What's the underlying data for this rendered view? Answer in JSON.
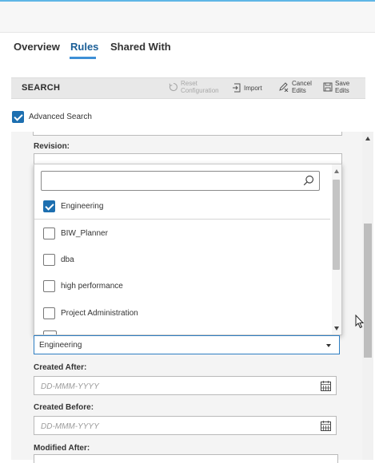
{
  "tabs": [
    {
      "label": "Overview",
      "active": false
    },
    {
      "label": "Rules",
      "active": true
    },
    {
      "label": "Shared With",
      "active": false
    }
  ],
  "toolbar": {
    "title": "SEARCH",
    "reset_line1": "Reset",
    "reset_line2": "Configuration",
    "import_label": "Import",
    "cancel_line1": "Cancel",
    "cancel_line2": "Edits",
    "save_line1": "Save",
    "save_line2": "Edits"
  },
  "advanced_search": {
    "label": "Advanced Search",
    "checked": true
  },
  "form": {
    "revision_label": "Revision:",
    "group_select_value": "Engineering",
    "created_after_label": "Created After:",
    "created_after_placeholder": "DD-MMM-YYYY",
    "created_before_label": "Created Before:",
    "created_before_placeholder": "DD-MMM-YYYY",
    "modified_after_label": "Modified After:"
  },
  "dropdown": {
    "search_value": "",
    "options": [
      {
        "label": "Engineering",
        "checked": true
      },
      {
        "label": "BIW_Planner",
        "checked": false
      },
      {
        "label": "dba",
        "checked": false
      },
      {
        "label": "high performance",
        "checked": false
      },
      {
        "label": "Project Administration",
        "checked": false
      }
    ]
  },
  "colors": {
    "accent": "#1d6fb0",
    "active_tab": "#1b5f97",
    "focus_border": "#2e7ec2"
  },
  "icons": [
    "search-icon",
    "reset-icon",
    "import-icon",
    "cancel-edits-icon",
    "save-icon",
    "calendar-icon",
    "chevron-down-icon"
  ]
}
